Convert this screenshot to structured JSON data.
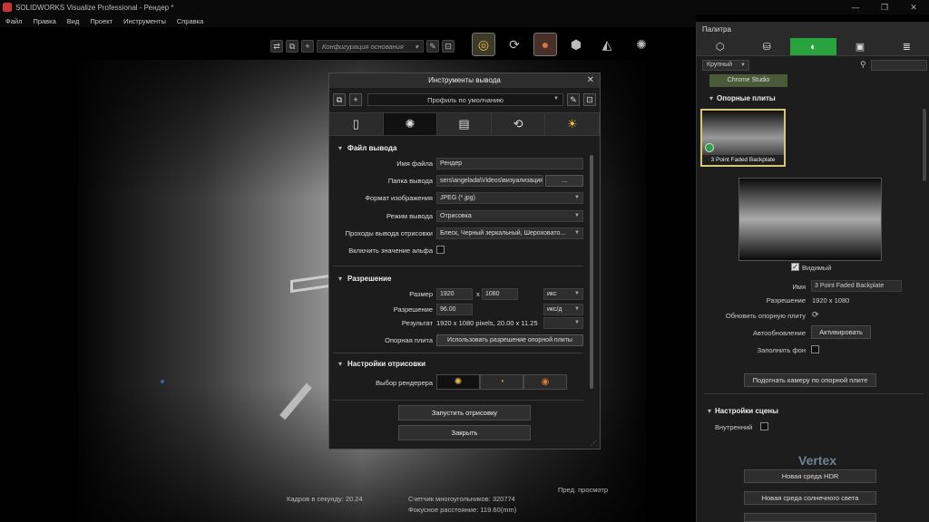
{
  "window": {
    "title": "SOLIDWORKS Visualize Professional - Рендер *",
    "minimize": "—",
    "maximize": "❐",
    "close": "✕"
  },
  "menu": [
    "Файл",
    "Правка",
    "Вид",
    "Проект",
    "Инструменты",
    "Справка"
  ],
  "toolbar": {
    "configuration": "Конфигурация основания"
  },
  "status": {
    "fps": "Кадров в секунду: 20.24",
    "polycount": "Счетчик многоугольников: 320774",
    "focal": "Фокусное расстояние: 119.60(mm)",
    "preview": "Пред. просмотр"
  },
  "dialog": {
    "title": "Инструменты вывода",
    "close": "✕",
    "profile": "Профиль по умолчанию",
    "sections": {
      "output_file": "Файл вывода",
      "resolution": "Разрешение",
      "render_settings": "Настройки отрисовки"
    },
    "fields": {
      "filename_label": "Имя файла",
      "filename_value": "Рендер",
      "folder_label": "Папка вывода",
      "folder_value": "sers\\angelada\\Videos\\визуализация",
      "folder_browse": "...",
      "format_label": "Формат изображения",
      "format_value": "JPEG (*.jpg)",
      "mode_label": "Режим вывода",
      "mode_value": "Отрисовка",
      "passes_label": "Проходы вывода отрисовки",
      "passes_value": "Блеск, Черный зеркальный, Шероховато...",
      "alpha_label": "Включить значение альфа",
      "size_label": "Размер",
      "width": "1920",
      "x": "x",
      "height": "1080",
      "size_unit": "икс",
      "res_label": "Разрешение",
      "res_value": "96.00",
      "res_unit": "икс/д",
      "result_label": "Результат",
      "result_value": "1920 x 1080 pixels, 20.00 x 11.25",
      "backplate_label": "Опорная плита",
      "backplate_button": "Использовать разрешение опорной плиты",
      "renderer_label": "Выбор рендерера"
    },
    "start_button": "Запустить отрисовку",
    "close_button": "Закрыть"
  },
  "palette": {
    "title": "Палитра",
    "size": "Крупный",
    "studio": "Chrome Studio",
    "backplates_section": "Опорные плиты",
    "thumb_caption": "3 Point Faded Backplate",
    "visible_label": "Видимый",
    "name_label": "Имя",
    "name_value": "3 Point Faded Backplate",
    "res_label": "Разрешение",
    "res_value": "1920 x 1080",
    "update_label": "Обновить опорную плиту",
    "autoupdate_label": "Автообновление",
    "activate_button": "Активировать",
    "fill_label": "Заполнить фон",
    "fit_button": "Подогнать камеру по опорной плите",
    "scene_section": "Настройки сцены",
    "interior_label": "Внутренний",
    "hdr_button": "Новая среда HDR",
    "sun_button": "Новая среда солнечного света"
  },
  "watermark": "Vertex"
}
